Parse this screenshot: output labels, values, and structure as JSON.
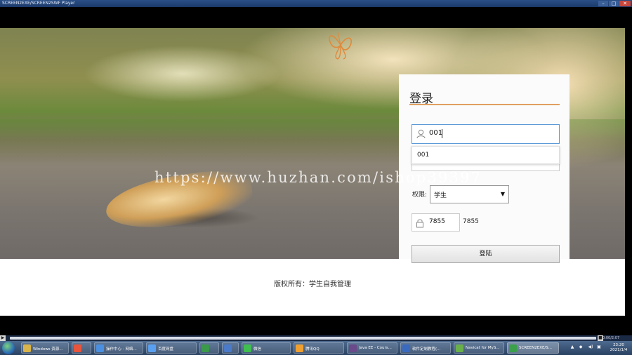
{
  "window": {
    "title": "SCREEN2EXE/SCREEN2SWF Player",
    "min": "–",
    "max": "□",
    "close": "✕"
  },
  "watermark": "https://www.huzhan.com/ishop39397",
  "login": {
    "heading": "登录",
    "username_value": "001",
    "autocomplete_option": "001",
    "role_label": "权限:",
    "role_value": "学生",
    "captcha_value": "7855",
    "captcha_text": "7855",
    "submit_label": "登陆"
  },
  "footer": {
    "copyright": "版权所有：学生自我管理"
  },
  "player": {
    "play": "▶",
    "stop": "■",
    "time": "0:00/2:07"
  },
  "taskbar": {
    "items": [
      {
        "label": "Windows 资源...",
        "color": "#d9b44a"
      },
      {
        "label": "",
        "color": "#e8553c"
      },
      {
        "label": "操作中心 - 网络...",
        "color": "#4a8fe0"
      },
      {
        "label": "百度网盘",
        "color": "#5aa0f0"
      },
      {
        "label": "",
        "color": "#3a9a4a"
      },
      {
        "label": "",
        "color": "#4a7ac8"
      },
      {
        "label": "微信",
        "color": "#3fbf4f"
      },
      {
        "label": "腾讯QQ",
        "color": "#f0a030"
      },
      {
        "label": "Java EE - Cours...",
        "color": "#6a4a8a"
      },
      {
        "label": "软件定制教程(...",
        "color": "#3a6ac0"
      },
      {
        "label": "Navicat for MyS...",
        "color": "#6ab04a"
      },
      {
        "label": "SCREEN2EXE/S...",
        "color": "#3aa04a"
      }
    ],
    "tray_icons": [
      "▲",
      "◆",
      "◀)",
      "▣"
    ],
    "time": "23:20",
    "date": "2021/1/4"
  }
}
